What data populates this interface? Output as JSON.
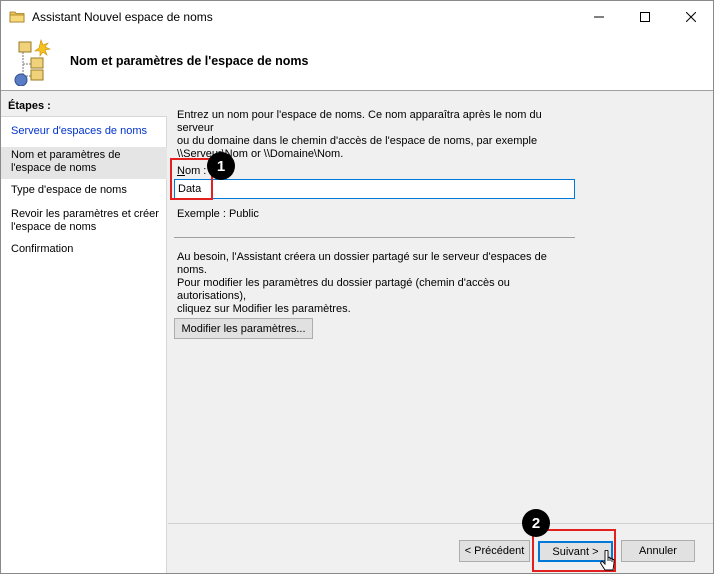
{
  "window": {
    "title": "Assistant Nouvel espace de noms",
    "minimize_icon": "minimize-icon",
    "maximize_icon": "maximize-icon",
    "close_icon": "close-icon"
  },
  "header": {
    "title": "Nom et paramètres de l'espace de noms",
    "icon": "namespace-wizard-icon"
  },
  "steps": {
    "heading": "Étapes :",
    "items": [
      {
        "label": "Serveur d'espaces de noms",
        "state": "link"
      },
      {
        "label": "Nom et paramètres de l'espace de noms",
        "state": "current"
      },
      {
        "label": "Type d'espace de noms",
        "state": "normal"
      },
      {
        "label": "Revoir les paramètres et créer l'espace de noms",
        "state": "normal"
      },
      {
        "label": "Confirmation",
        "state": "normal"
      }
    ]
  },
  "main": {
    "intro_line1": "Entrez un nom pour l'espace de noms. Ce nom apparaîtra après le nom du serveur",
    "intro_line2": "ou du domaine dans le chemin d'accès de l'espace de noms, par exemple",
    "intro_line3": "\\\\Serveur\\Nom or \\\\Domaine\\Nom.",
    "name_label_accel": "N",
    "name_label_rest": "om :",
    "name_value": "Data",
    "example": "Exemple : Public",
    "help_line1": "Au besoin, l'Assistant créera un dossier partagé sur le serveur d'espaces de noms.",
    "help_line2": "Pour modifier les paramètres du dossier partagé (chemin d'accès ou autorisations),",
    "help_line3": "cliquez sur Modifier les paramètres.",
    "modify_button": "Modifier les paramètres..."
  },
  "footer": {
    "previous_button": "< Précédent",
    "next_button": "Suivant >",
    "cancel_button": "Annuler"
  },
  "annotations": {
    "badge1": "1",
    "badge2": "2",
    "highlight_color": "#e32020"
  },
  "colors": {
    "link": "#0033cc",
    "focus": "#0078d7"
  }
}
